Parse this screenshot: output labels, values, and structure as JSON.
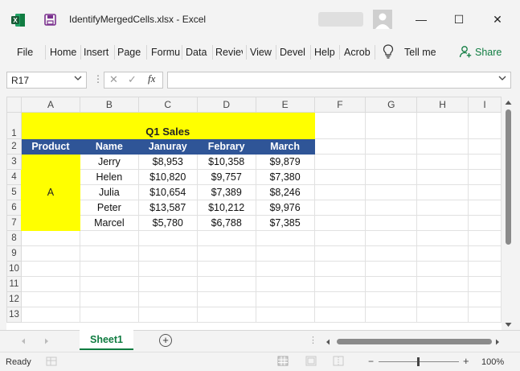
{
  "window": {
    "title": "IdentifyMergedCells.xlsx  -  Excel",
    "minimize": "—",
    "maximize": "☐",
    "close": "✕"
  },
  "ribbon": {
    "tabs": [
      "File",
      "Home",
      "Insert",
      "Page",
      "Formu",
      "Data",
      "Reviev",
      "View",
      "Devel",
      "Help",
      "Acrob"
    ],
    "tell_me": "Tell me",
    "share": "Share"
  },
  "formula_bar": {
    "name_box": "R17",
    "cancel": "✕",
    "enter": "✓",
    "fx": "fx",
    "formula": ""
  },
  "grid": {
    "columns": [
      "A",
      "B",
      "C",
      "D",
      "E",
      "F",
      "G",
      "H",
      "I"
    ],
    "rows": [
      "1",
      "2",
      "3",
      "4",
      "5",
      "6",
      "7",
      "8",
      "9",
      "10",
      "11",
      "12",
      "13"
    ],
    "title": "Q1 Sales",
    "headers": [
      "Product",
      "Name",
      "Januray",
      "Febrary",
      "March"
    ],
    "product": "A",
    "records": [
      [
        "Jerry",
        "$8,953",
        "$10,358",
        "$9,879"
      ],
      [
        "Helen",
        "$10,820",
        "$9,757",
        "$7,380"
      ],
      [
        "Julia",
        "$10,654",
        "$7,389",
        "$8,246"
      ],
      [
        "Peter",
        "$13,587",
        "$10,212",
        "$9,976"
      ],
      [
        "Marcel",
        "$5,780",
        "$6,788",
        "$7,385"
      ]
    ]
  },
  "sheets": {
    "active": "Sheet1",
    "add": "+"
  },
  "status": {
    "ready": "Ready",
    "zoom": "100%",
    "zoom_fraction": 0.5
  },
  "colors": {
    "accent": "#107c41",
    "header_fill": "#2f5597",
    "highlight": "#ffff00"
  }
}
